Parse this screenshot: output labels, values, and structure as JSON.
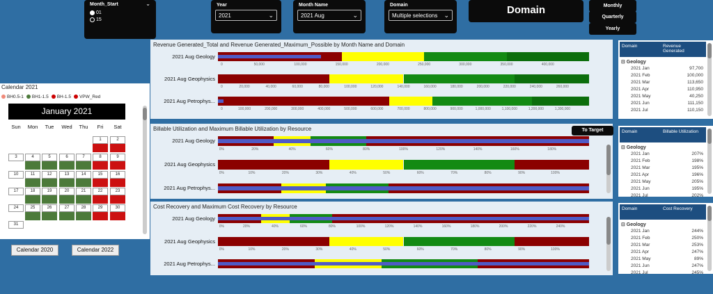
{
  "filters": {
    "month_start": {
      "title": "Month_Start",
      "options": [
        "01",
        "15"
      ]
    },
    "year": {
      "title": "Year",
      "value": "2021"
    },
    "month_name": {
      "title": "Month Name",
      "value": "2021 Aug"
    },
    "domain": {
      "title": "Domain",
      "value": "Multiple selections"
    }
  },
  "domain_header": "Domain",
  "period_buttons": [
    "Monthly",
    "Quarterly",
    "Yearly"
  ],
  "to_target_label": "To Target",
  "calendar": {
    "title": "Calendar 2021",
    "legend": [
      {
        "label": "BH0.5-1",
        "color": "#f08a7a"
      },
      {
        "label": "BH1-1.5",
        "color": "#4c7a3a"
      },
      {
        "label": "BH-1.5",
        "color": "#cc0000"
      },
      {
        "label": "VPW_Red",
        "color": "#cc0000"
      }
    ],
    "month": "January 2021",
    "dow": [
      "Sun",
      "Mon",
      "Tue",
      "Wed",
      "Thu",
      "Fri",
      "Sat"
    ],
    "prev_button": "Calendar 2020",
    "next_button": "Calendar 2022"
  },
  "colors": {
    "dark_red": "#8b0000",
    "yellow": "#ffff00",
    "green": "#138a13",
    "dark_green": "#0c6e0c",
    "bar": "#4f5bc6"
  },
  "chart_data": [
    {
      "type": "bar",
      "title": "Revenue Generated_Total and Revenue Generated_Maximum_Possible by Month Name and Domain",
      "rows": [
        {
          "label": "2021 Aug Geology",
          "ticks": [
            "0",
            "50,000",
            "100,000",
            "150,000",
            "200,000",
            "250,000",
            "300,000",
            "350,000",
            "400,000"
          ],
          "max": 450000,
          "value": 125000,
          "bands": [
            {
              "start": 0,
              "end": 150000,
              "color": "dark_red"
            },
            {
              "start": 150000,
              "end": 250000,
              "color": "yellow"
            },
            {
              "start": 250000,
              "end": 350000,
              "color": "green"
            },
            {
              "start": 350000,
              "end": 450000,
              "color": "dark_green"
            }
          ]
        },
        {
          "label": "2021 Aug Geophysics",
          "ticks": [
            "0",
            "20,000",
            "40,000",
            "60,000",
            "80,000",
            "100,000",
            "120,000",
            "140,000",
            "160,000",
            "180,000",
            "200,000",
            "220,000",
            "240,000",
            "260,000"
          ],
          "max": 260000,
          "value": 0,
          "bands": [
            {
              "start": 0,
              "end": 78000,
              "color": "dark_red"
            },
            {
              "start": 78000,
              "end": 130000,
              "color": "yellow"
            },
            {
              "start": 130000,
              "end": 208000,
              "color": "green"
            },
            {
              "start": 208000,
              "end": 260000,
              "color": "dark_green"
            }
          ]
        },
        {
          "label": "2021 Aug Petrophys...",
          "ticks": [
            "0",
            "100,000",
            "200,000",
            "300,000",
            "400,000",
            "500,000",
            "600,000",
            "700,000",
            "800,000",
            "900,000",
            "1,000,000",
            "1,100,000",
            "1,200,000",
            "1,300,000"
          ],
          "max": 1300000,
          "value": 20000,
          "bands": [
            {
              "start": 0,
              "end": 600000,
              "color": "dark_red"
            },
            {
              "start": 600000,
              "end": 750000,
              "color": "yellow"
            },
            {
              "start": 750000,
              "end": 1100000,
              "color": "green"
            },
            {
              "start": 1100000,
              "end": 1300000,
              "color": "dark_green"
            }
          ]
        }
      ],
      "table": {
        "headers": [
          "Domain",
          "Revenue Generated"
        ],
        "group": "Geology",
        "rows": [
          [
            "2021 Jan",
            "97,700"
          ],
          [
            "2021 Feb",
            "100,000"
          ],
          [
            "2021 Mar",
            "113,650"
          ],
          [
            "2021 Apr",
            "110,950"
          ],
          [
            "2021 May",
            "40,250"
          ],
          [
            "2021 Jun",
            "111,150"
          ],
          [
            "2021 Jul",
            "110,150"
          ]
        ]
      }
    },
    {
      "type": "bar",
      "title": "Billable Utilization and Maximum Billable Utilization by Resource",
      "rows": [
        {
          "label": "2021 Aug Geology",
          "ticks": [
            "0%",
            "20%",
            "40%",
            "60%",
            "80%",
            "100%",
            "120%",
            "140%",
            "160%",
            "180%"
          ],
          "max": 200,
          "value": 200,
          "bands": [
            {
              "start": 0,
              "end": 30,
              "color": "dark_red"
            },
            {
              "start": 30,
              "end": 50,
              "color": "yellow"
            },
            {
              "start": 50,
              "end": 80,
              "color": "green"
            },
            {
              "start": 80,
              "end": 200,
              "color": "dark_red"
            }
          ]
        },
        {
          "label": "2021 Aug Geophysics",
          "ticks": [
            "0%",
            "10%",
            "20%",
            "30%",
            "40%",
            "50%",
            "60%",
            "70%",
            "80%",
            "90%",
            "100%"
          ],
          "max": 100,
          "value": 0,
          "bands": [
            {
              "start": 0,
              "end": 30,
              "color": "dark_red"
            },
            {
              "start": 30,
              "end": 50,
              "color": "yellow"
            },
            {
              "start": 50,
              "end": 80,
              "color": "green"
            },
            {
              "start": 80,
              "end": 100,
              "color": "dark_red"
            }
          ]
        },
        {
          "label": "2021 Aug Petrophys...",
          "ticks": [],
          "max": 100,
          "value": 100,
          "bands": [
            {
              "start": 0,
              "end": 17,
              "color": "dark_red"
            },
            {
              "start": 17,
              "end": 29,
              "color": "yellow"
            },
            {
              "start": 29,
              "end": 46,
              "color": "green"
            },
            {
              "start": 46,
              "end": 100,
              "color": "dark_red"
            }
          ]
        }
      ],
      "table": {
        "headers": [
          "Domain",
          "Billable Utilization"
        ],
        "group": "Geology",
        "rows": [
          [
            "2021 Jan",
            "207%"
          ],
          [
            "2021 Feb",
            "198%"
          ],
          [
            "2021 Mar",
            "195%"
          ],
          [
            "2021 Apr",
            "196%"
          ],
          [
            "2021 May",
            "205%"
          ],
          [
            "2021 Jun",
            "195%"
          ],
          [
            "2021 Jul",
            "202%"
          ]
        ]
      }
    },
    {
      "type": "bar",
      "title": "Cost Recovery and Maximum Cost Recovery by Resource",
      "rows": [
        {
          "label": "2021 Aug Geology",
          "ticks": [
            "0%",
            "20%",
            "40%",
            "60%",
            "80%",
            "100%",
            "120%",
            "140%",
            "160%",
            "180%",
            "200%",
            "220%",
            "240%"
          ],
          "max": 260,
          "value": 260,
          "bands": [
            {
              "start": 0,
              "end": 30,
              "color": "dark_red"
            },
            {
              "start": 30,
              "end": 50,
              "color": "yellow"
            },
            {
              "start": 50,
              "end": 80,
              "color": "green"
            },
            {
              "start": 80,
              "end": 260,
              "color": "dark_red"
            }
          ]
        },
        {
          "label": "2021 Aug Geophysics",
          "ticks": [
            "0%",
            "10%",
            "20%",
            "30%",
            "40%",
            "50%",
            "60%",
            "70%",
            "80%",
            "90%",
            "100%"
          ],
          "max": 100,
          "value": 0,
          "bands": [
            {
              "start": 0,
              "end": 30,
              "color": "dark_red"
            },
            {
              "start": 30,
              "end": 50,
              "color": "yellow"
            },
            {
              "start": 50,
              "end": 80,
              "color": "green"
            },
            {
              "start": 80,
              "end": 100,
              "color": "dark_red"
            }
          ]
        },
        {
          "label": "2021 Aug Petrophys...",
          "ticks": [],
          "max": 100,
          "value": 100,
          "bands": [
            {
              "start": 0,
              "end": 26,
              "color": "dark_red"
            },
            {
              "start": 26,
              "end": 44,
              "color": "yellow"
            },
            {
              "start": 44,
              "end": 70,
              "color": "green"
            },
            {
              "start": 70,
              "end": 100,
              "color": "dark_red"
            }
          ]
        }
      ],
      "table": {
        "headers": [
          "Domain",
          "Cost Recovery"
        ],
        "group": "Geology",
        "rows": [
          [
            "2021 Jan",
            "244%"
          ],
          [
            "2021 Feb",
            "250%"
          ],
          [
            "2021 Mar",
            "253%"
          ],
          [
            "2021 Apr",
            "247%"
          ],
          [
            "2021 May",
            "89%"
          ],
          [
            "2021 Jun",
            "247%"
          ],
          [
            "2021 Jul",
            "245%"
          ]
        ]
      }
    }
  ]
}
